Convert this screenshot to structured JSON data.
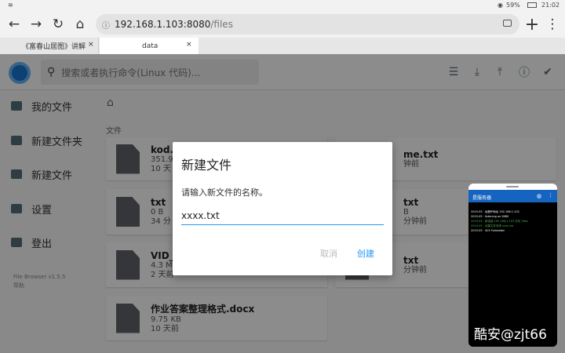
{
  "status_bar": {
    "time": "21:02",
    "battery": "59%"
  },
  "browser": {
    "url_host": "192.168.1.103:8080",
    "url_path": "/files"
  },
  "tabs": [
    {
      "label": "《富春山居图》讲解",
      "close": "×"
    },
    {
      "label": "data",
      "close": "×"
    }
  ],
  "app": {
    "search_placeholder": "搜索或者执行命令(Linux 代码)...",
    "sidebar": [
      "我的文件",
      "新建文件夹",
      "新建文件",
      "设置",
      "登出"
    ],
    "version": "File Browser v1.5.5",
    "help": "帮助",
    "section_label": "文件",
    "files": [
      {
        "name": "kod.lo",
        "size": "351.9",
        "time": "10 天"
      },
      {
        "name": "me.txt",
        "size": "",
        "time": "钟前"
      },
      {
        "name": "txt",
        "size": "0 B",
        "time": "34 分"
      },
      {
        "name": "txt",
        "size": "B",
        "time": "分钟前"
      },
      {
        "name": "VID_2",
        "size": "4.3 M",
        "time": "2 天前"
      },
      {
        "name": "txt",
        "size": "",
        "time": "分钟前"
      },
      {
        "name": "作业答案整理格式.docx",
        "size": "9.75 KB",
        "time": "10 天前"
      }
    ]
  },
  "dialog": {
    "title": "新建文件",
    "message": "请输入新文件的名称。",
    "input_value": "xxxx.txt",
    "cancel": "取消",
    "create": "创建"
  },
  "mini_window": {
    "title": "是服务器",
    "log": [
      "2019-05 · 远程IP地址 192.168.1.102",
      "2019-05 · listening on 8080",
      "2019-05 · 新连接 192.168.1.103 访问 /files",
      "2019-05 · 创建文件请求 xxxx.txt",
      "2019-05 · 403 Forbidden"
    ]
  },
  "watermark": "酷安@zjt66",
  "colors": {
    "accent": "#2196f3",
    "icon": "#546e7a",
    "log_green": "#4caf50"
  }
}
